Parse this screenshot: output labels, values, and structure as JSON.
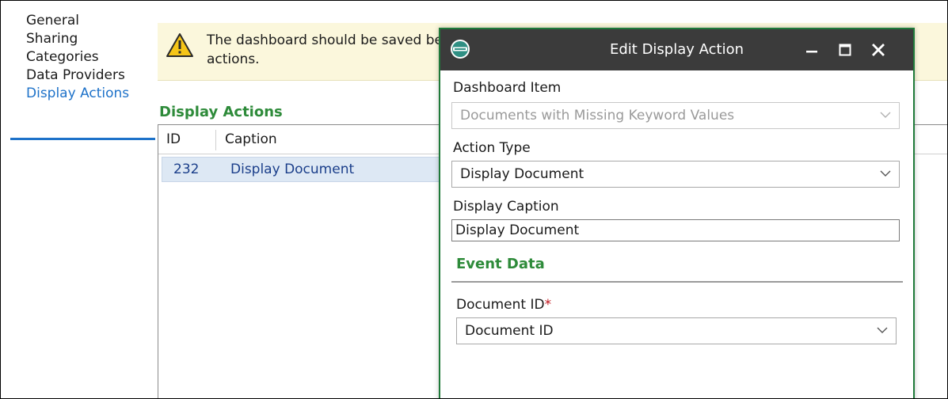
{
  "nav": {
    "items": [
      {
        "label": "General"
      },
      {
        "label": "Sharing"
      },
      {
        "label": "Categories"
      },
      {
        "label": "Data Providers"
      },
      {
        "label": "Display Actions"
      }
    ]
  },
  "banner": {
    "line1": "The dashboard should be saved before configuring dashboard",
    "line2": "actions."
  },
  "section": {
    "title": "Display Actions"
  },
  "grid": {
    "columns": [
      "ID",
      "Caption"
    ],
    "rows": [
      {
        "id": "232",
        "caption": "Display Document"
      }
    ]
  },
  "dialog": {
    "title": "Edit Display Action",
    "dashboard_item": {
      "label": "Dashboard Item",
      "value": "Documents with Missing Keyword Values"
    },
    "action_type": {
      "label": "Action Type",
      "value": "Display Document"
    },
    "display_caption": {
      "label": "Display Caption",
      "value": "Display Document"
    },
    "event_data": {
      "title": "Event Data",
      "document_id": {
        "label": "Document ID",
        "required_mark": "*",
        "value": "Document ID"
      }
    }
  },
  "colors": {
    "accent_blue": "#1e72c9",
    "section_green": "#2e8b3a",
    "titlebar": "#3b3b3b",
    "banner_bg": "#fbf7dc"
  },
  "icons": {
    "warning": "warning-icon",
    "app": "app-logo-icon",
    "minimize": "minimize-icon",
    "maximize": "maximize-icon",
    "close": "close-icon",
    "chevron": "chevron-down-icon"
  }
}
